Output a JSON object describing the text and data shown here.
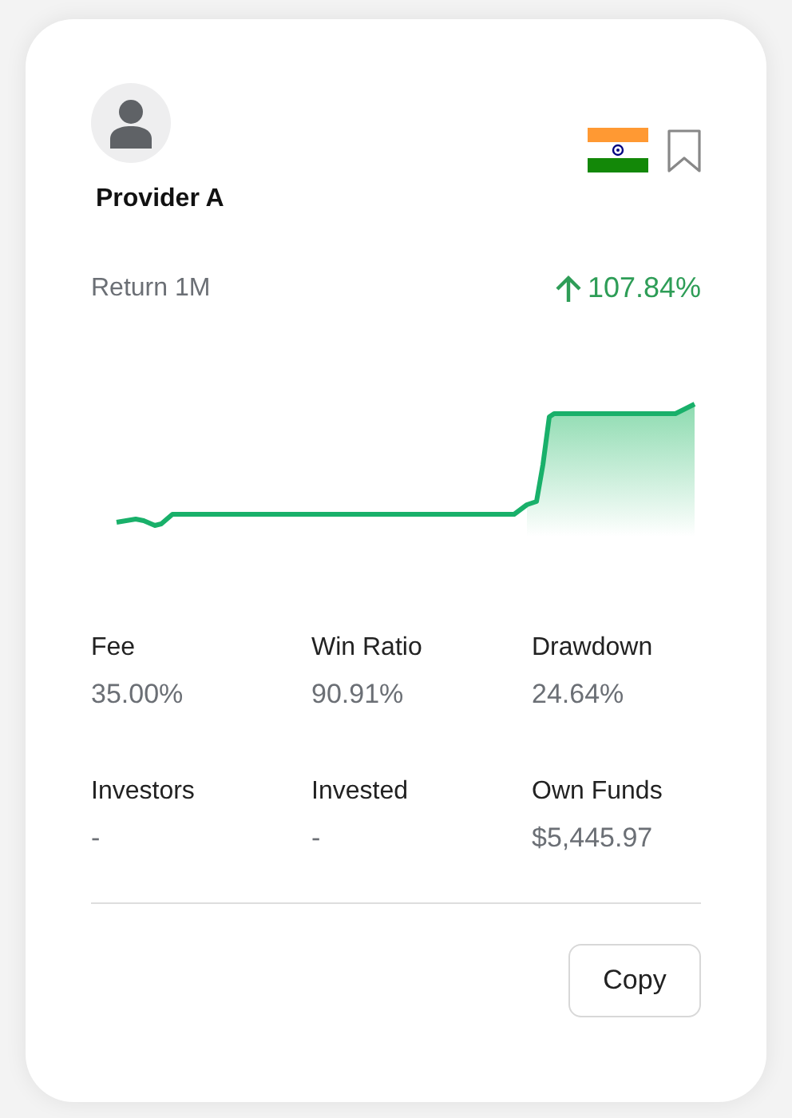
{
  "provider": {
    "name": "Provider A",
    "bookmarked": false
  },
  "return": {
    "label": "Return 1M",
    "value": "107.84%",
    "positive": true
  },
  "stats": [
    {
      "label": "Fee",
      "value": "35.00%"
    },
    {
      "label": "Win Ratio",
      "value": "90.91%"
    },
    {
      "label": "Drawdown",
      "value": "24.64%"
    },
    {
      "label": "Investors",
      "value": "-"
    },
    {
      "label": "Invested",
      "value": "-"
    },
    {
      "label": "Own Funds",
      "value": "$5,445.97"
    }
  ],
  "button": "Copy"
}
